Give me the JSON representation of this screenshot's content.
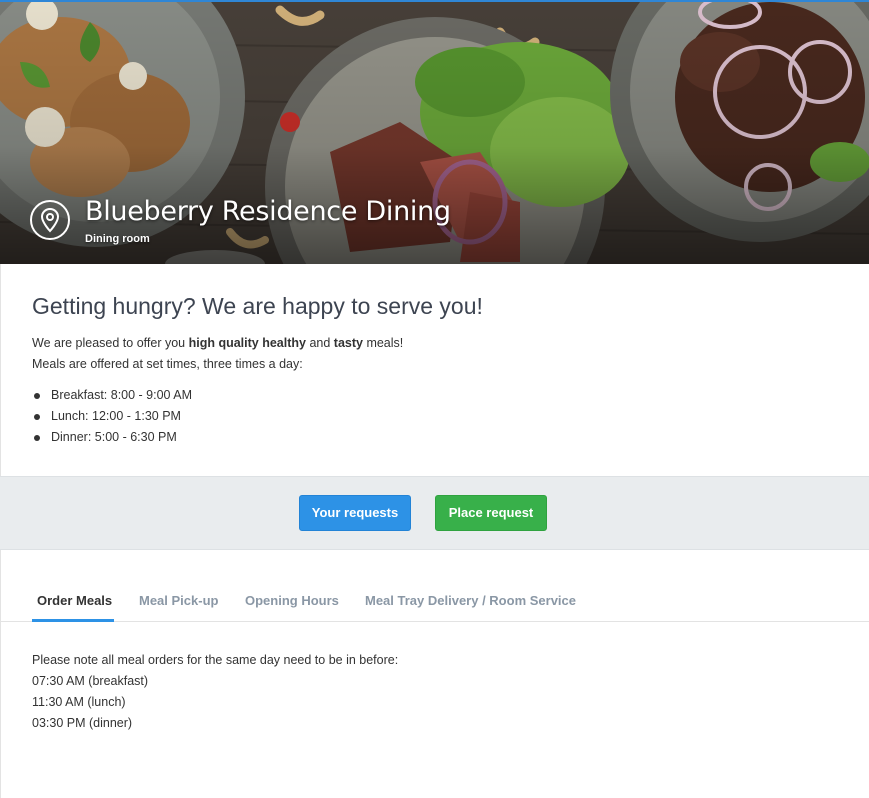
{
  "hero": {
    "title": "Blueberry Residence Dining",
    "subtitle": "Dining room",
    "location_icon": "map-pin-icon"
  },
  "intro": {
    "heading": "Getting hungry? We are happy to serve you!",
    "line1_prefix": "We are pleased to offer you ",
    "line1_bold1": "high quality healthy",
    "line1_mid": " and ",
    "line1_bold2": "tasty",
    "line1_suffix": " meals!",
    "line2": "Meals are offered at set times, three times a day:",
    "meals": [
      "Breakfast: 8:00 - 9:00 AM",
      "Lunch: 12:00 - 1:30 PM",
      "Dinner: 5:00 - 6:30 PM"
    ]
  },
  "actions": {
    "your_requests": "Your requests",
    "place_request": "Place request",
    "blue": "#2d92e6",
    "green": "#38b04a"
  },
  "tabs": [
    {
      "label": "Order Meals",
      "active": true
    },
    {
      "label": "Meal Pick-up",
      "active": false
    },
    {
      "label": "Opening Hours",
      "active": false
    },
    {
      "label": "Meal Tray Delivery / Room Service",
      "active": false
    }
  ],
  "content": {
    "note": "Please note all meal orders for the same day need to be in before:",
    "deadlines": [
      "07:30 AM (breakfast)",
      "11:30 AM (lunch)",
      "03:30 PM (dinner)"
    ]
  }
}
